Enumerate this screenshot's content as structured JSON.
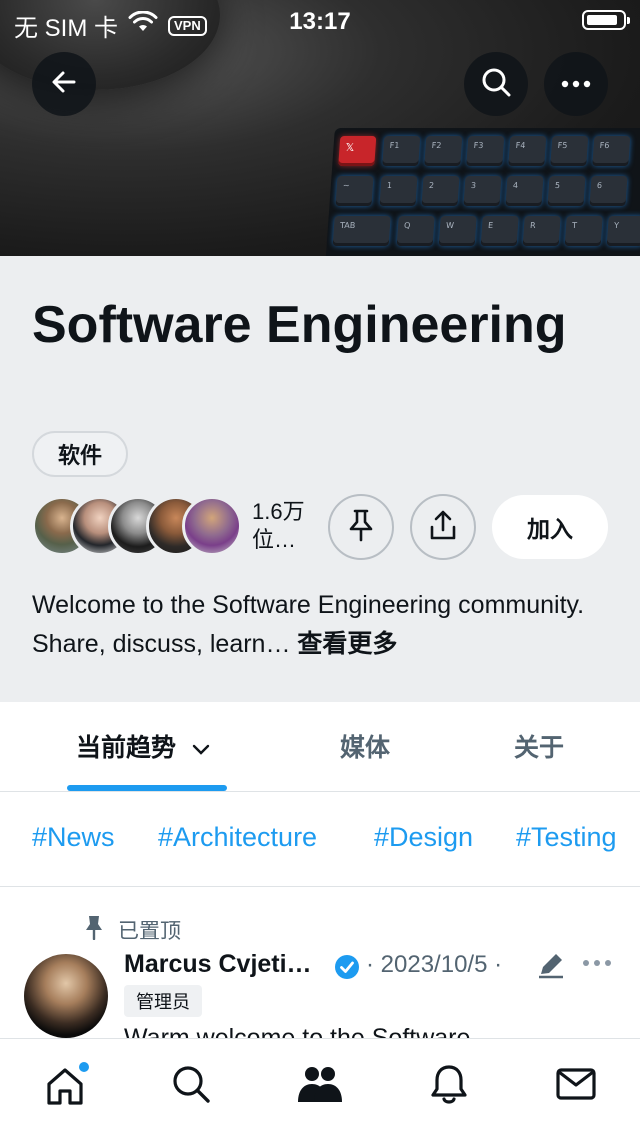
{
  "status_bar": {
    "carrier": "无 SIM 卡",
    "vpn": "VPN",
    "time": "13:17"
  },
  "header": {
    "back_icon": "arrow-left-icon",
    "search_icon": "search-icon",
    "more_icon": "more-horizontal-icon"
  },
  "community": {
    "title": "Software Engineering",
    "tag": "软件",
    "members": "1.6万\n位…",
    "pin_icon": "pin-icon",
    "share_icon": "share-icon",
    "join_label": "加入",
    "description": "Welcome to the Software Engineering community. Share, discuss, learn… ",
    "see_more": "查看更多"
  },
  "tabs": [
    {
      "label": "当前趋势",
      "active": true
    },
    {
      "label": "媒体",
      "active": false
    },
    {
      "label": "关于",
      "active": false
    }
  ],
  "hashtags": [
    "#News",
    "#Architecture",
    "#Design",
    "#Testing"
  ],
  "post": {
    "pinned_label": "已置顶",
    "author": "Marcus Cvjeti…",
    "date": "· 2023/10/5 ·",
    "badge": "管理员",
    "text": "Warm welcome to the Software"
  },
  "bottom_nav": [
    {
      "name": "home-icon",
      "has_notification_dot": true
    },
    {
      "name": "search-icon"
    },
    {
      "name": "communities-icon"
    },
    {
      "name": "notifications-icon"
    },
    {
      "name": "messages-icon"
    }
  ],
  "colors": {
    "accent": "#1d9bf0",
    "text": "#0f1419",
    "secondary_text": "#536471",
    "header_bg": "#eceef0"
  }
}
